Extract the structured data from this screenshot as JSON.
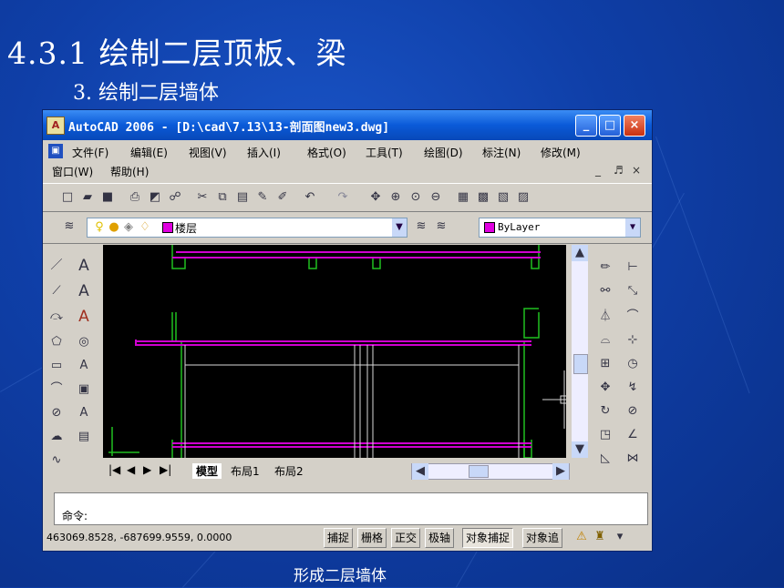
{
  "slide": {
    "title": "4.3.1 绘制二层顶板、梁",
    "subtitle": "3. 绘制二层墙体",
    "caption": "形成二层墙体"
  },
  "window": {
    "title": "AutoCAD 2006 - [D:\\cad\\7.13\\13-剖面图new3.dwg]",
    "minimize_glyph": "_",
    "maximize_glyph": "□",
    "close_glyph": "×"
  },
  "menu": {
    "items": [
      "文件(F)",
      "编辑(E)",
      "视图(V)",
      "插入(I)",
      "格式(O)",
      "工具(T)",
      "绘图(D)",
      "标注(N)",
      "修改(M)"
    ],
    "items_row2": [
      "窗口(W)",
      "帮助(H)"
    ],
    "mdi_controls": [
      "_",
      "♬",
      "×"
    ]
  },
  "layer_toolbar": {
    "layer_name": "楼层",
    "color_value": "ByLayer"
  },
  "layout_tabs": [
    "模型",
    "布局1",
    "布局2"
  ],
  "command_line": {
    "prompt": "命令:"
  },
  "status_bar": {
    "coordinates": "463069.8528, -687699.9559, 0.0000",
    "buttons": [
      "捕捉",
      "栅格",
      "正交",
      "极轴",
      "对象捕捉",
      "对象追"
    ],
    "active_button": "对象捕捉"
  },
  "colors": {
    "wall_line": "#d000d0",
    "structure_line": "#20c020",
    "column_line": "#d8d8d8",
    "swatch": "#e000e0"
  },
  "icons": {
    "draw_tools": [
      "line-icon",
      "construction-line-icon",
      "polyline-icon",
      "polygon-icon",
      "rectangle-icon",
      "arc-icon",
      "circle-icon",
      "revision-cloud-icon",
      "spline-icon"
    ],
    "text_tools": [
      "text-icon",
      "multiline-text-icon",
      "edit-text-icon",
      "find-text-icon",
      "spell-icon",
      "scale-text-icon",
      "justify-text-icon",
      "table-icon"
    ],
    "modify_tools": [
      "erase-icon",
      "copy-icon",
      "mirror-icon",
      "offset-icon",
      "array-icon",
      "move-icon",
      "rotate-icon",
      "scale-icon",
      "stretch-icon"
    ],
    "dimension_tools": [
      "linear-dim-icon",
      "aligned-dim-icon",
      "arc-length-icon",
      "ordinate-icon",
      "radius-icon",
      "jogged-icon",
      "diameter-icon",
      "angular-icon",
      "quick-dim-icon"
    ]
  }
}
